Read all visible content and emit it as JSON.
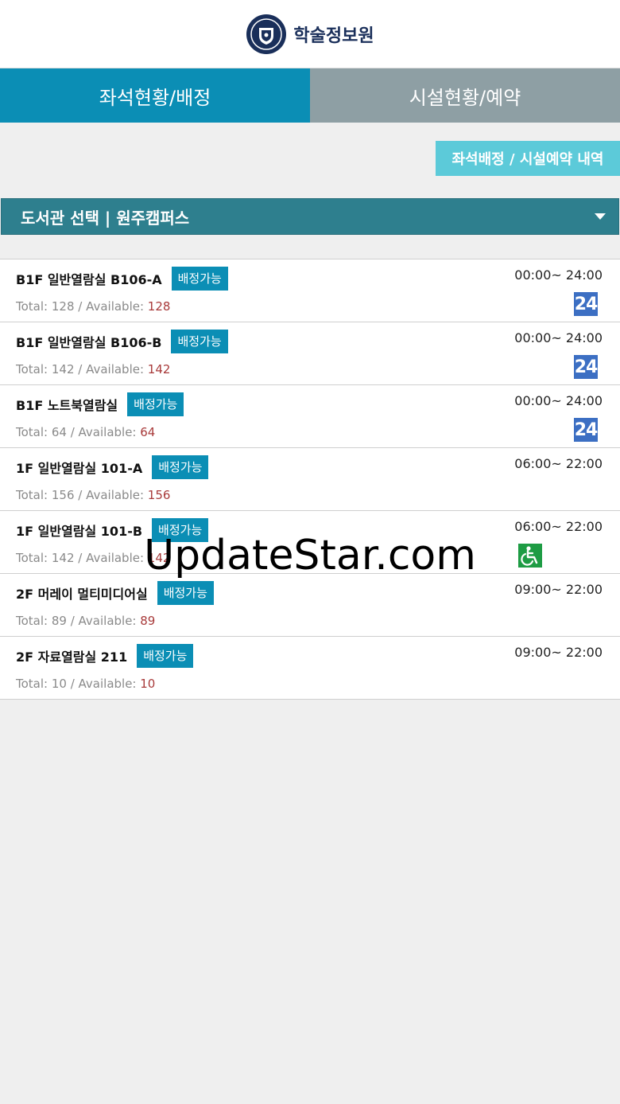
{
  "header": {
    "title": "학술정보원"
  },
  "tabs": [
    {
      "label": "좌석현황/배정",
      "active": true
    },
    {
      "label": "시설현황/예약",
      "active": false
    }
  ],
  "history_button": "좌석배정 / 시설예약 내역",
  "library_select": {
    "label": "도서관 선택 | 원주캠퍼스"
  },
  "rooms": [
    {
      "name": "B1F 일반열람실 B106-A",
      "badge": "배정가능",
      "total_label": "Total: 128 / Available: ",
      "available": "128",
      "hours": "00:00~ 24:00",
      "icon": "24",
      "icon_type": "24h-icon"
    },
    {
      "name": "B1F 일반열람실 B106-B",
      "badge": "배정가능",
      "total_label": "Total: 142 / Available: ",
      "available": "142",
      "hours": "00:00~ 24:00",
      "icon": "24",
      "icon_type": "24h-icon"
    },
    {
      "name": "B1F 노트북열람실",
      "badge": "배정가능",
      "total_label": "Total: 64 / Available: ",
      "available": "64",
      "hours": "00:00~ 24:00",
      "icon": "24",
      "icon_type": "24h-icon"
    },
    {
      "name": "1F 일반열람실 101-A",
      "badge": "배정가능",
      "total_label": "Total: 156 / Available: ",
      "available": "156",
      "hours": "06:00~ 22:00",
      "icon": "",
      "icon_type": ""
    },
    {
      "name": "1F 일반열람실 101-B",
      "badge": "배정가능",
      "total_label": "Total: 142 / Available: ",
      "available": "142",
      "hours": "06:00~ 22:00",
      "icon": "",
      "icon_type": "wheelchair-icon"
    },
    {
      "name": "2F 머레이 멀티미디어실",
      "badge": "배정가능",
      "total_label": "Total: 89 / Available: ",
      "available": "89",
      "hours": "09:00~ 22:00",
      "icon": "",
      "icon_type": ""
    },
    {
      "name": "2F 자료열람실 211",
      "badge": "배정가능",
      "total_label": "Total: 10 / Available: ",
      "available": "10",
      "hours": "09:00~ 22:00",
      "icon": "",
      "icon_type": ""
    }
  ],
  "watermark": "UpdateStar.com",
  "colors": {
    "tab_active": "#0b8eb5",
    "tab_inactive": "#8e9fa4",
    "select_bar": "#2e7f8e",
    "history_button": "#5ccad9",
    "badge": "#0b8eb5",
    "icon_24": "#3c6fc3",
    "icon_wheelchair": "#1e9c44"
  }
}
